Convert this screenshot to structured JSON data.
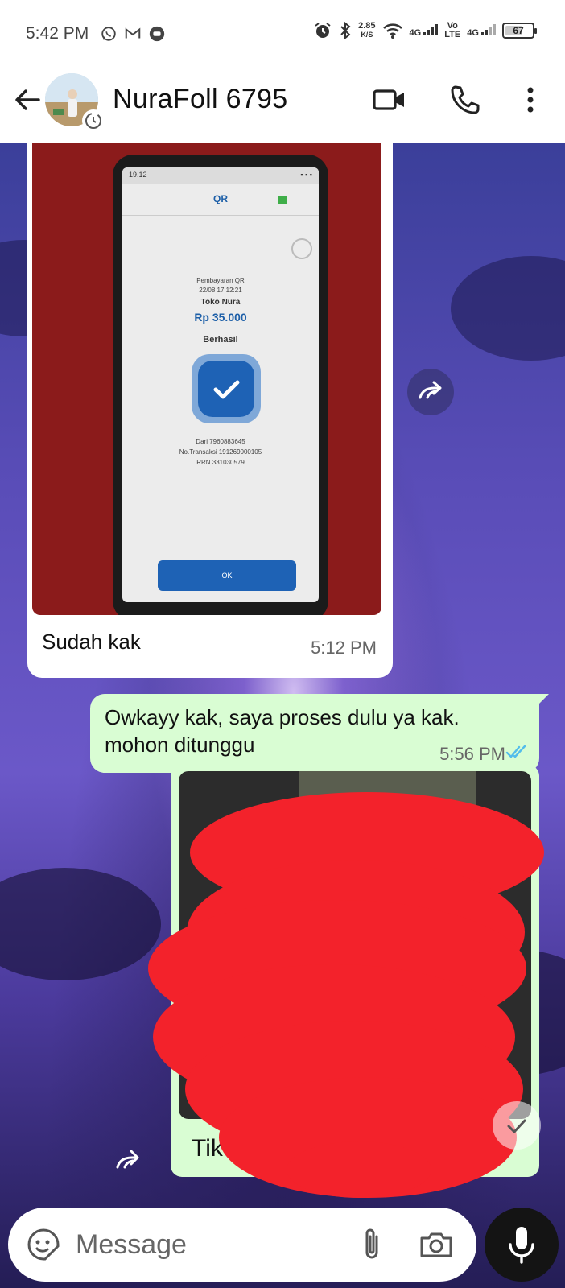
{
  "status_bar": {
    "time": "5:42 PM",
    "speed_value": "2.85",
    "speed_unit": "K/S",
    "net1": "4G",
    "volte_top": "Vo",
    "volte_bottom": "LTE",
    "net2": "4G",
    "battery": "67",
    "battery_level_percent": 67
  },
  "header": {
    "contact_name": "NuraFoll 6795"
  },
  "messages": [
    {
      "direction": "in",
      "type": "image",
      "caption": "Sudah kak",
      "time": "5:12 PM",
      "photo": {
        "status_time": "19.12",
        "title": "QR",
        "label": "Pembayaran QR",
        "datetime": "22/08 17:12:21",
        "merchant": "Toko Nura",
        "amount": "Rp 35.000",
        "result": "Berhasil",
        "from": "Dari 7960883645",
        "trx": "No.Transaksi 191269000105",
        "rrn": "RRN 331030579",
        "ok": "OK"
      }
    },
    {
      "direction": "out",
      "type": "text",
      "text": "Owkayy kak, saya proses dulu ya kak. mohon ditunggu",
      "time": "5:56 PM",
      "status": "read"
    },
    {
      "direction": "out",
      "type": "image",
      "caption": "Tik"
    }
  ],
  "composer": {
    "placeholder": "Message"
  },
  "icons": {
    "back": "arrow-left-icon",
    "video": "video-camera-icon",
    "call": "phone-icon",
    "menu": "more-vertical-icon",
    "emoji": "sticker-icon",
    "attach": "paperclip-icon",
    "camera": "camera-icon",
    "mic": "microphone-icon",
    "forward": "forward-icon"
  },
  "colors": {
    "outgoing_bubble": "#d9fdd3",
    "incoming_bubble": "#ffffff",
    "read_ticks": "#53bdeb",
    "redaction": "#f3222b"
  }
}
